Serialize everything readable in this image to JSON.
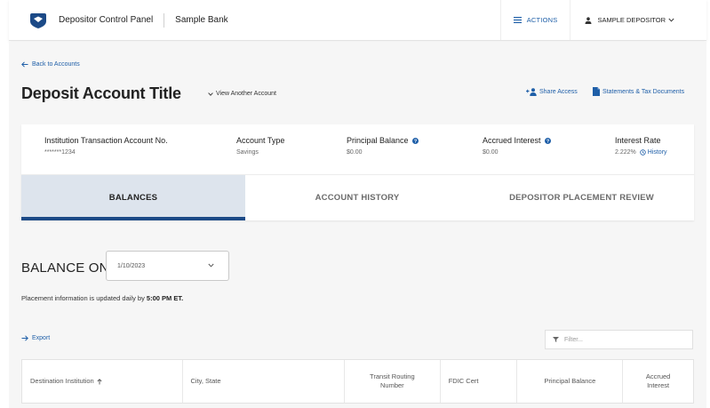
{
  "header": {
    "app_title": "Depositor Control Panel",
    "bank_name": "Sample Bank",
    "actions_label": "ACTIONS",
    "user_label": "SAMPLE DEPOSITOR"
  },
  "nav": {
    "back_label": "Back to Accounts"
  },
  "page": {
    "title": "Deposit Account Title",
    "view_another_label": "View Another Account",
    "share_access_label": "Share Access",
    "statements_label": "Statements & Tax Documents"
  },
  "summary": {
    "account_no_label": "Institution Transaction Account No.",
    "account_no_value": "*******1234",
    "account_type_label": "Account Type",
    "account_type_value": "Savings",
    "principal_label": "Principal Balance",
    "principal_value": "$0.00",
    "accrued_label": "Accrued Interest",
    "accrued_value": "$0.00",
    "rate_label": "Interest Rate",
    "rate_value": "2.222%",
    "history_label": "History"
  },
  "tabs": [
    {
      "label": "BALANCES",
      "active": true
    },
    {
      "label": "ACCOUNT HISTORY",
      "active": false
    },
    {
      "label": "DEPOSITOR PLACEMENT REVIEW",
      "active": false
    }
  ],
  "balance": {
    "heading": "BALANCE ON",
    "date_value": "1/10/2023",
    "info_prefix": "Placement information is updated daily by",
    "info_time": "5:00 PM ET."
  },
  "table": {
    "export_label": "Export",
    "filter_placeholder": "Filter...",
    "columns": [
      "Destination Institution",
      "City, State",
      "Transit Routing Number",
      "FDIC Cert",
      "Principal Balance",
      "Accrued Interest"
    ]
  },
  "colors": {
    "accent": "#1f5fa8",
    "active_tab_bg": "#dde4ed",
    "active_tab_bar": "#1c4a87"
  }
}
